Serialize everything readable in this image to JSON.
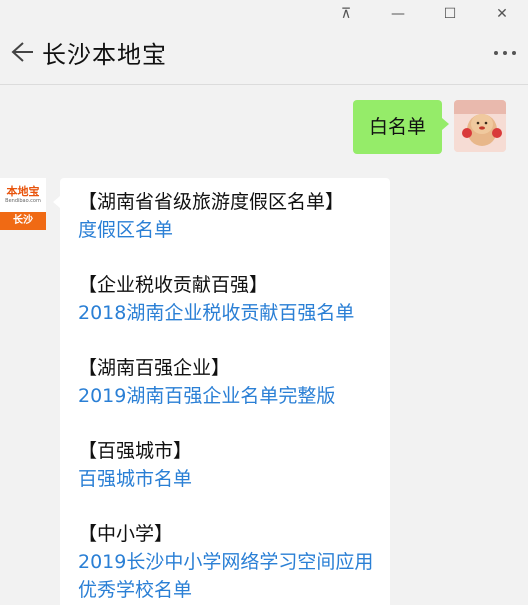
{
  "window": {
    "controls": {
      "pin": "⊼",
      "minimize": "—",
      "maximize": "☐",
      "close": "✕"
    }
  },
  "header": {
    "title": "长沙本地宝"
  },
  "outgoing": {
    "message": "白名单"
  },
  "incoming": {
    "avatar": {
      "logo_text": "本地宝",
      "logo_sub": "Bendibao.com",
      "city": "长沙"
    },
    "entries": [
      {
        "heading": "【湖南省省级旅游度假区名单】",
        "link": "度假区名单"
      },
      {
        "heading": "【企业税收贡献百强】",
        "link": "2018湖南企业税收贡献百强名单"
      },
      {
        "heading": "【湖南百强企业】",
        "link": "2019湖南百强企业名单完整版"
      },
      {
        "heading": "【百强城市】",
        "link": "百强城市名单"
      },
      {
        "heading": "【中小学】",
        "link": "2019长沙中小学网络学习空间应用优秀学校名单"
      }
    ]
  },
  "colors": {
    "outgoing_bubble": "#95ec69",
    "link": "#2a7fd5",
    "brand_orange": "#f06a14"
  }
}
